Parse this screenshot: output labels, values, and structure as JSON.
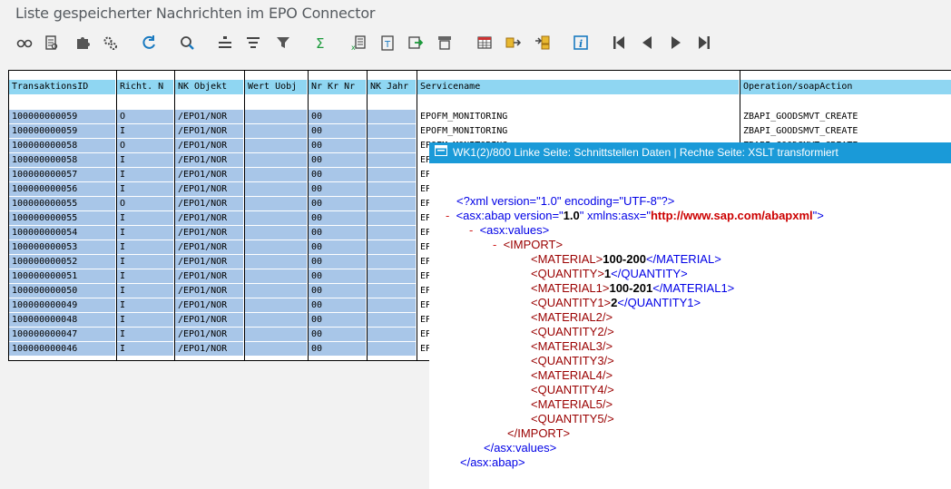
{
  "window": {
    "title": "Liste gespeicherter Nachrichten im EPO Connector"
  },
  "toolbar": {
    "buttons": [
      {
        "icon": "glasses-icon"
      },
      {
        "icon": "document-search-icon"
      },
      {
        "icon": "puzzle-icon"
      },
      {
        "icon": "gears-icon"
      },
      {
        "icon": "refresh-icon"
      },
      {
        "icon": "find-icon"
      },
      {
        "icon": "align-icon"
      },
      {
        "icon": "sort-icon"
      },
      {
        "icon": "filter-icon"
      },
      {
        "icon": "sum-icon"
      },
      {
        "icon": "export-icon"
      },
      {
        "icon": "print-icon"
      },
      {
        "icon": "save-icon"
      },
      {
        "icon": "layout-icon"
      },
      {
        "icon": "table-icon"
      },
      {
        "icon": "select-layout-icon"
      },
      {
        "icon": "change-layout-icon"
      },
      {
        "icon": "info-icon"
      },
      {
        "icon": "first-page-icon"
      },
      {
        "icon": "previous-page-icon"
      },
      {
        "icon": "next-page-icon"
      },
      {
        "icon": "last-page-icon"
      }
    ]
  },
  "grid": {
    "columns": [
      "TransaktionsID",
      "Richt. N",
      "NK Objekt",
      "Wert Uobj",
      "Nr Kr Nr",
      "NK Jahr",
      "Servicename",
      "Operation/soapAction"
    ],
    "rows": [
      {
        "id": "100000000059",
        "dir": "O",
        "obj": "/EPO1/NOR",
        "nr": "00",
        "service": "EPOFM_MONITORING",
        "op": "ZBAPI_GOODSMVT_CREATE"
      },
      {
        "id": "100000000059",
        "dir": "I",
        "obj": "/EPO1/NOR",
        "nr": "00",
        "service": "EPOFM_MONITORING",
        "op": "ZBAPI_GOODSMVT_CREATE"
      },
      {
        "id": "100000000058",
        "dir": "O",
        "obj": "/EPO1/NOR",
        "nr": "00",
        "service": "EPOFM_MONITORING",
        "op": "ZBAPI_GOODSMVT_CREATE"
      },
      {
        "id": "100000000058",
        "dir": "I",
        "obj": "/EPO1/NOR",
        "nr": "00",
        "service": "EP",
        "op": ""
      },
      {
        "id": "100000000057",
        "dir": "I",
        "obj": "/EPO1/NOR",
        "nr": "00",
        "service": "EP",
        "op": ""
      },
      {
        "id": "100000000056",
        "dir": "I",
        "obj": "/EPO1/NOR",
        "nr": "00",
        "service": "EP",
        "op": ""
      },
      {
        "id": "100000000055",
        "dir": "O",
        "obj": "/EPO1/NOR",
        "nr": "00",
        "service": "EP",
        "op": ""
      },
      {
        "id": "100000000055",
        "dir": "I",
        "obj": "/EPO1/NOR",
        "nr": "00",
        "service": "EP",
        "op": ""
      },
      {
        "id": "100000000054",
        "dir": "I",
        "obj": "/EPO1/NOR",
        "nr": "00",
        "service": "EP",
        "op": ""
      },
      {
        "id": "100000000053",
        "dir": "I",
        "obj": "/EPO1/NOR",
        "nr": "00",
        "service": "EP",
        "op": ""
      },
      {
        "id": "100000000052",
        "dir": "I",
        "obj": "/EPO1/NOR",
        "nr": "00",
        "service": "EP",
        "op": ""
      },
      {
        "id": "100000000051",
        "dir": "I",
        "obj": "/EPO1/NOR",
        "nr": "00",
        "service": "EP",
        "op": ""
      },
      {
        "id": "100000000050",
        "dir": "I",
        "obj": "/EPO1/NOR",
        "nr": "00",
        "service": "EP",
        "op": ""
      },
      {
        "id": "100000000049",
        "dir": "I",
        "obj": "/EPO1/NOR",
        "nr": "00",
        "service": "EP",
        "op": ""
      },
      {
        "id": "100000000048",
        "dir": "I",
        "obj": "/EPO1/NOR",
        "nr": "00",
        "service": "EP",
        "op": ""
      },
      {
        "id": "100000000047",
        "dir": "I",
        "obj": "/EPO1/NOR",
        "nr": "00",
        "service": "EP",
        "op": ""
      },
      {
        "id": "100000000046",
        "dir": "I",
        "obj": "/EPO1/NOR",
        "nr": "00",
        "service": "EP",
        "op": ""
      }
    ]
  },
  "popup": {
    "title": "WK1(2)/800 Linke Seite: Schnittstellen Daten | Rechte Seite: XSLT transformiert",
    "xml": {
      "decl": "<?xml version=\"1.0\" encoding=\"UTF-8\"?>",
      "abap_open_prefix": "<asx:abap version=\"",
      "abap_version": "1.0",
      "abap_xmlns": "\" xmlns:asx=\"",
      "abap_url": "http://www.sap.com/abapxml",
      "abap_close_q": "\">",
      "values_open": "<asx:values>",
      "import_open": "<IMPORT>",
      "material_open": "<MATERIAL>",
      "material_val": "100-200",
      "material_close": "</MATERIAL>",
      "quantity_open": "<QUANTITY>",
      "quantity_val": "1",
      "quantity_close": "</QUANTITY>",
      "material1_open": "<MATERIAL1>",
      "material1_val": "100-201",
      "material1_close": "</MATERIAL1>",
      "quantity1_open": "<QUANTITY1>",
      "quantity1_val": "2",
      "quantity1_close": "</QUANTITY1>",
      "empty": [
        "<MATERIAL2/>",
        "<QUANTITY2/>",
        "<MATERIAL3/>",
        "<QUANTITY3/>",
        "<MATERIAL4/>",
        "<QUANTITY4/>",
        "<MATERIAL5/>",
        "<QUANTITY5/>"
      ],
      "import_close": "</IMPORT>",
      "values_close": "</asx:values>",
      "abap_close": "</asx:abap>",
      "minus": "-"
    }
  },
  "colors": {
    "header_bg": "#8fd6f2",
    "selection": "#a8c6e8",
    "popup_title_bg": "#1a9ad8"
  }
}
